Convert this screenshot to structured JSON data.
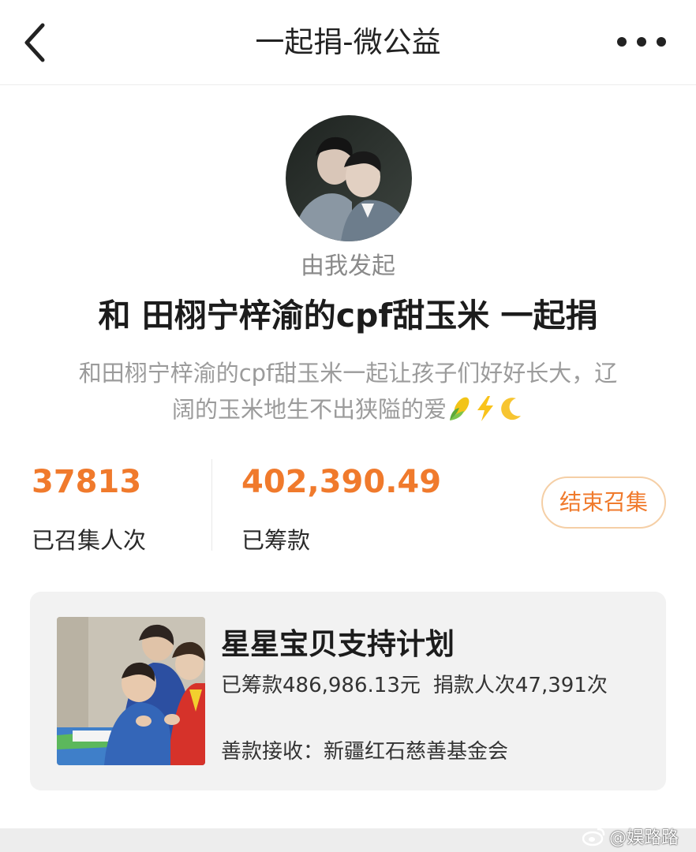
{
  "header": {
    "title": "一起捐-微公益",
    "back_icon": "chevron-left-icon",
    "more_icon": "more-dots-icon"
  },
  "campaign": {
    "initiator": "由我发起",
    "title": "和 田栩宁梓渝的cpf甜玉米 一起捐",
    "description_line1": "和田栩宁梓渝的cpf甜玉米一起让孩子们好好长大，辽",
    "description_line2": "阔的玉米地生不出狭隘的爱",
    "description_emojis": [
      "corn-icon",
      "lightning-icon",
      "crescent-moon-icon"
    ]
  },
  "stats": {
    "participants_value": "37813",
    "participants_label": "已召集人次",
    "raised_value": "402,390.49",
    "raised_label": "已筹款",
    "end_button": "结束召集"
  },
  "project": {
    "name": "星星宝贝支持计划",
    "raised": "已筹款486,986.13元",
    "donors": "捐款人次47,391次",
    "receiver": "善款接收：新疆红石慈善基金会"
  },
  "watermark": "@娱路路",
  "colors": {
    "accent": "#f07a2c",
    "accent_border": "#f5cfa6",
    "card_bg": "#f2f2f2",
    "muted_text": "#9b9b9b"
  }
}
